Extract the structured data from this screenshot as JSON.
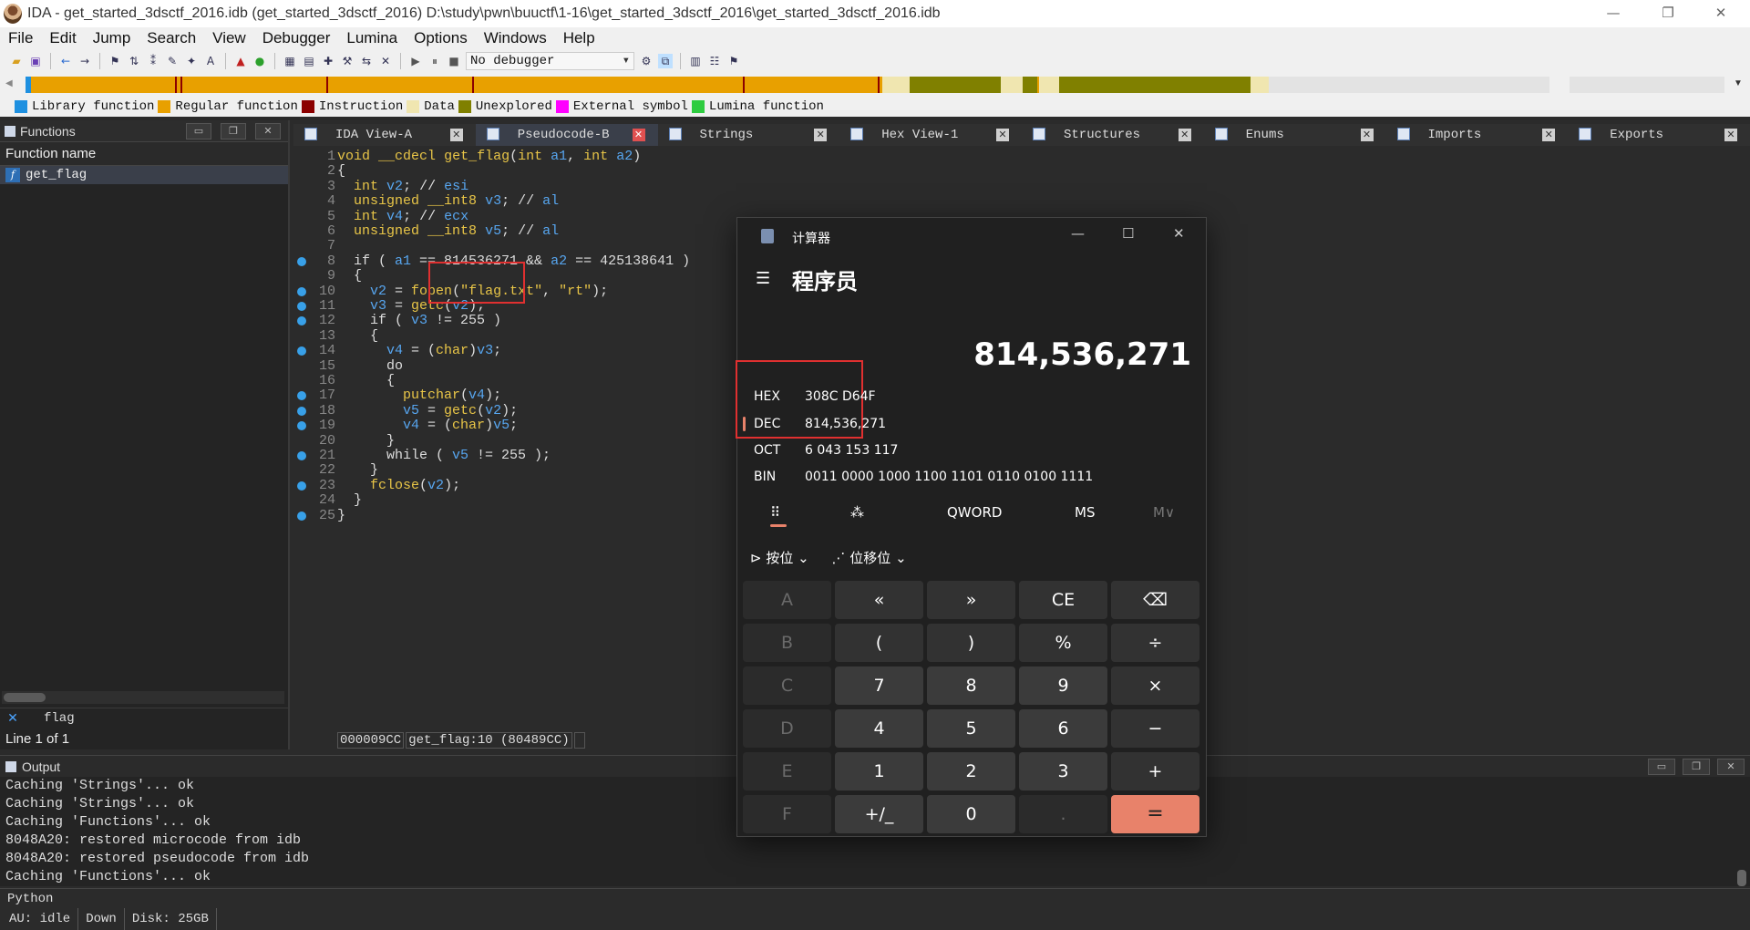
{
  "window": {
    "title": "IDA - get_started_3dsctf_2016.idb (get_started_3dsctf_2016) D:\\study\\pwn\\buuctf\\1-16\\get_started_3dsctf_2016\\get_started_3dsctf_2016.idb"
  },
  "menu": [
    "File",
    "Edit",
    "Jump",
    "Search",
    "View",
    "Debugger",
    "Lumina",
    "Options",
    "Windows",
    "Help"
  ],
  "toolbar": {
    "debugger": "No debugger"
  },
  "legend": [
    {
      "label": "Library function",
      "color": "#1e90e0"
    },
    {
      "label": "Regular function",
      "color": "#e8a000"
    },
    {
      "label": "Instruction",
      "color": "#8b0000"
    },
    {
      "label": "Data",
      "color": "#f0e6b0"
    },
    {
      "label": "Unexplored",
      "color": "#808000"
    },
    {
      "label": "External symbol",
      "color": "#ff00ff"
    },
    {
      "label": "Lumina function",
      "color": "#2ecc40"
    }
  ],
  "functions": {
    "title": "Functions",
    "header": "Function name",
    "items": [
      "get_flag"
    ],
    "filter": "flag",
    "line_info": "Line 1 of 1"
  },
  "tabs": [
    {
      "label": "IDA View-A",
      "active": false
    },
    {
      "label": "Pseudocode-B",
      "active": true
    },
    {
      "label": "Strings",
      "active": false
    },
    {
      "label": "Hex View-1",
      "active": false
    },
    {
      "label": "Structures",
      "active": false
    },
    {
      "label": "Enums",
      "active": false
    },
    {
      "label": "Imports",
      "active": false
    },
    {
      "label": "Exports",
      "active": false
    }
  ],
  "code": [
    "void __cdecl get_flag(int a1, int a2)",
    "{",
    "  int v2; // esi",
    "  unsigned __int8 v3; // al",
    "  int v4; // ecx",
    "  unsigned __int8 v5; // al",
    "",
    "  if ( a1 == 814536271 && a2 == 425138641 )",
    "  {",
    "    v2 = fopen(\"flag.txt\", \"rt\");",
    "    v3 = getc(v2);",
    "    if ( v3 != 255 )",
    "    {",
    "      v4 = (char)v3;",
    "      do",
    "      {",
    "        putchar(v4);",
    "        v5 = getc(v2);",
    "        v4 = (char)v5;",
    "      }",
    "      while ( v5 != 255 );",
    "    }",
    "    fclose(v2);",
    "  }",
    "}"
  ],
  "code_status": {
    "addr": "000009CC",
    "loc": "get_flag:10 (80489CC)"
  },
  "output": {
    "title": "Output",
    "lines": [
      "Caching 'Strings'... ok",
      "Caching 'Strings'... ok",
      "Caching 'Functions'... ok",
      "8048A20: restored microcode from idb",
      "8048A20: restored pseudocode from idb",
      "Caching 'Functions'... ok"
    ]
  },
  "python_label": "Python",
  "status": {
    "au": "AU:  idle",
    "dir": "Down",
    "disk": "Disk: 25GB"
  },
  "calculator": {
    "title": "计算器",
    "mode": "程序员",
    "display": "814,536,271",
    "radix": [
      {
        "name": "HEX",
        "value": "308C D64F"
      },
      {
        "name": "DEC",
        "value": "814,536,271"
      },
      {
        "name": "OCT",
        "value": "6 043 153 117"
      },
      {
        "name": "BIN",
        "value": "0011 0000 1000 1100 1101 0110 0100 1111"
      }
    ],
    "word_size": "QWORD",
    "ms": "MS",
    "mem": "M∨",
    "bitwise": "按位",
    "bitshift": "位移位",
    "keys": [
      [
        "A",
        "«",
        "»",
        "CE",
        "⌫"
      ],
      [
        "B",
        "(",
        ")",
        "%",
        "÷"
      ],
      [
        "C",
        "7",
        "8",
        "9",
        "×"
      ],
      [
        "D",
        "4",
        "5",
        "6",
        "−"
      ],
      [
        "E",
        "1",
        "2",
        "3",
        "+"
      ],
      [
        "F",
        "+/_",
        "0",
        ".",
        "="
      ]
    ]
  }
}
